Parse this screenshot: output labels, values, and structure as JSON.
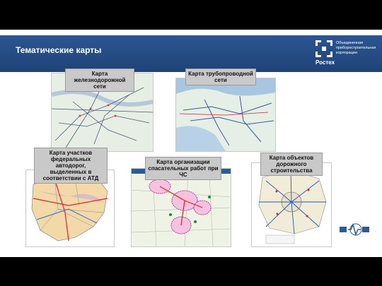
{
  "slide": {
    "title": "Тематические карты"
  },
  "logo": {
    "brand": "Ростех",
    "text": "Объединенная приборостроительная корпорация"
  },
  "maps": [
    {
      "caption": "Карта железнодорожной сети"
    },
    {
      "caption": "Карта трубопроводной сети"
    },
    {
      "caption": "Карта участков федеральных автодорог, выделенных в соответствии с АТД"
    },
    {
      "caption": "Карта организации спасательных работ при ЧС"
    },
    {
      "caption": "Карта объектов дорожного строительства"
    }
  ],
  "colors": {
    "header": "#2c5690",
    "caption_bg": "#c9c9c9"
  }
}
